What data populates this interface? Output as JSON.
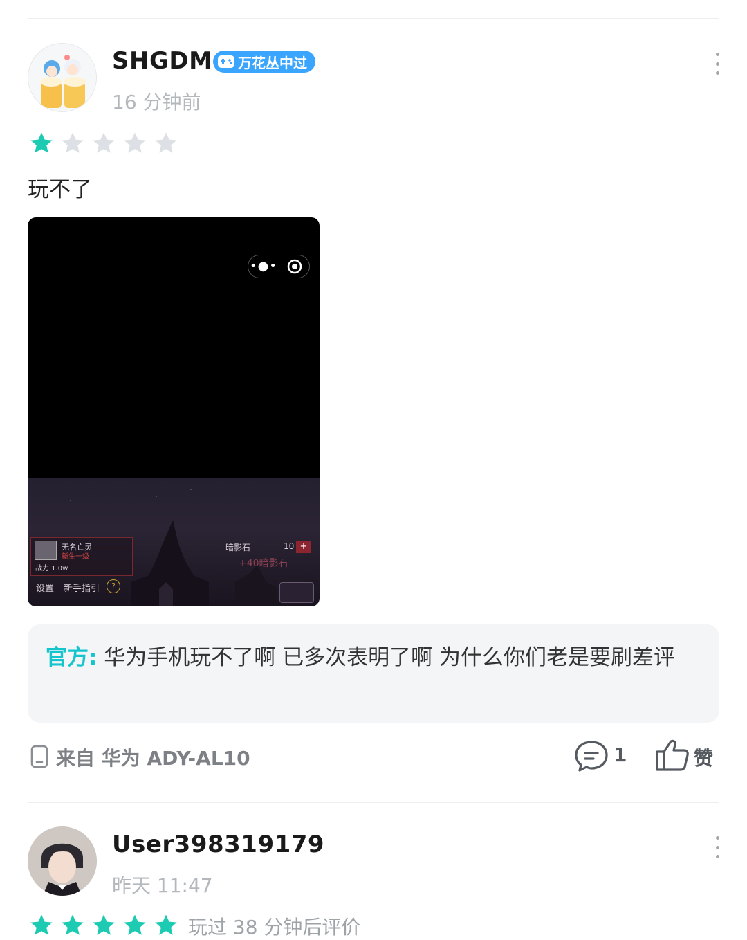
{
  "reviews": [
    {
      "username": "SHGDM",
      "badge": "万花丛中过",
      "time": "16 分钟前",
      "rating": 1,
      "text": "玩不了",
      "screenshot": {
        "player_name": "无名亡灵",
        "player_rank": "新生一级",
        "power": "战力 1.0w",
        "currency_label": "暗影石",
        "currency_value": "10",
        "plus": "+",
        "reward": "+40暗影石",
        "settings": "设置",
        "guide": "新手指引",
        "guide_q": "?"
      },
      "official_label": "官方:",
      "official_reply": "华为手机玩不了啊 已多次表明了啊 为什么你们老是要刷差评",
      "device": "来自 华为 ADY-AL10",
      "comments": "1",
      "like_label": "赞"
    },
    {
      "username": "User398319179",
      "time": "昨天 11:47",
      "rating": 5,
      "played_text": "玩过 38 分钟后评价"
    }
  ],
  "colors": {
    "star_on": "#1ccbb2",
    "star_off": "#dde0e4",
    "accent": "#15c5ce",
    "badge": "#3aa5ff"
  }
}
